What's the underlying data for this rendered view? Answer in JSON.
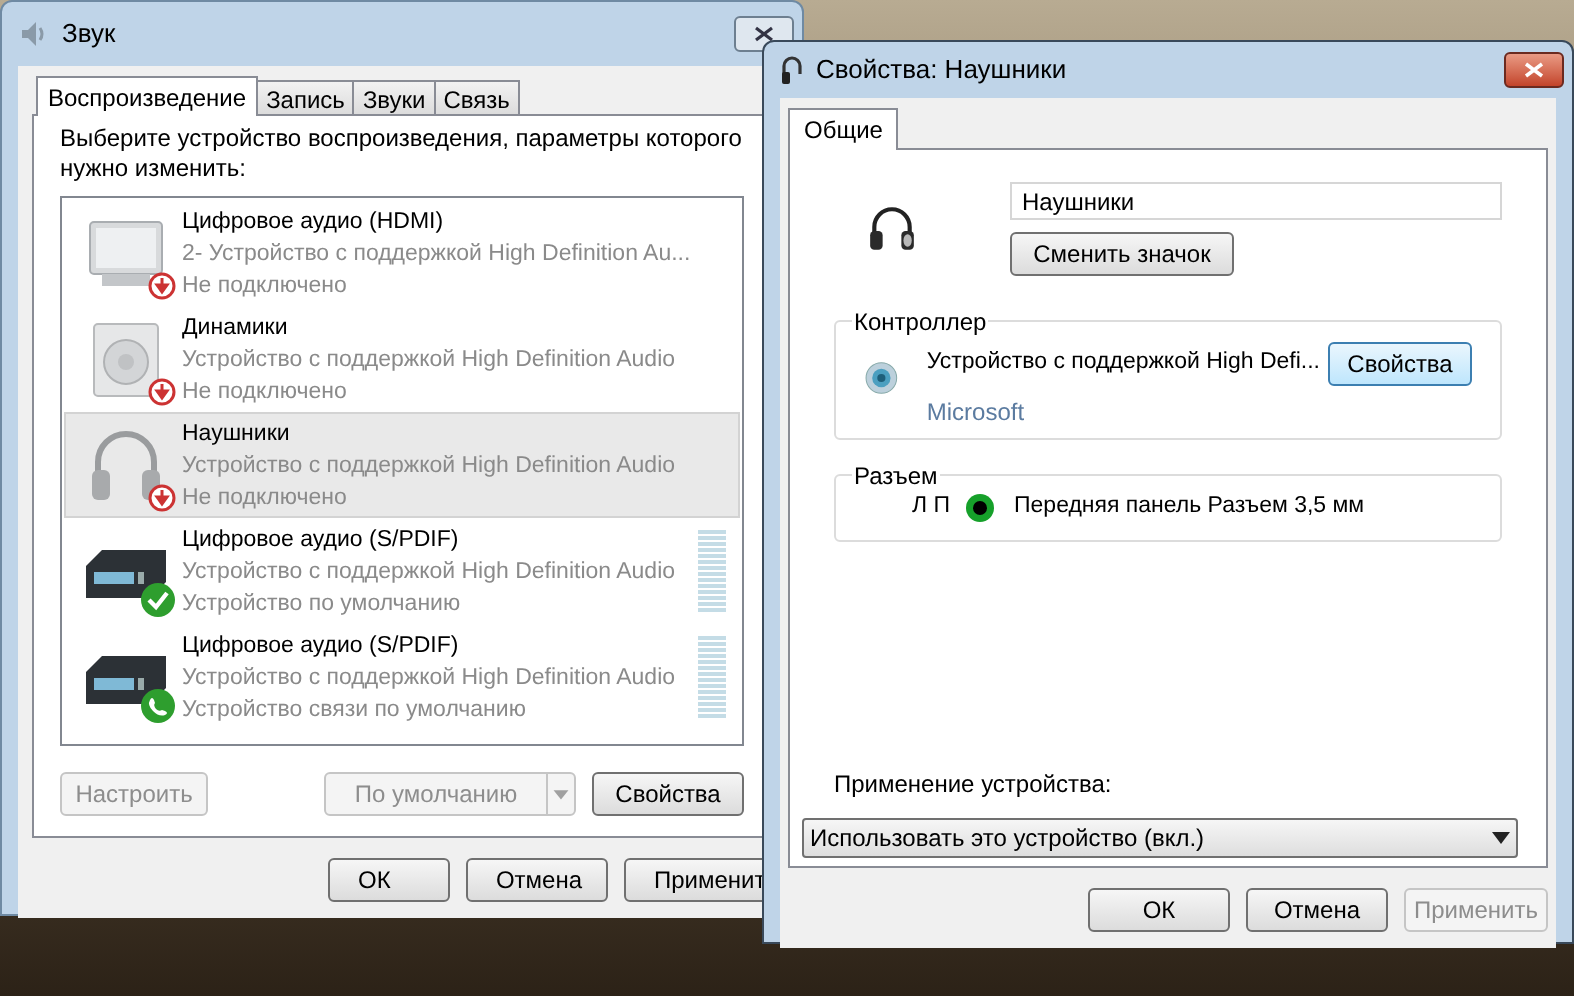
{
  "sound_window": {
    "title": "Звук",
    "tabs": [
      {
        "label": "Воспроизведение",
        "selected": true
      },
      {
        "label": "Запись",
        "selected": false
      },
      {
        "label": "Звуки",
        "selected": false
      },
      {
        "label": "Связь",
        "selected": false
      }
    ],
    "instruction": "Выберите устройство воспроизведения, параметры которого нужно изменить:",
    "devices": [
      {
        "name": "Цифровое аудио (HDMI)",
        "description": "2- Устройство с поддержкой High Definition Au...",
        "status": "Не подключено",
        "kind": "monitor",
        "badge": {
          "kind": "disconnected"
        },
        "selected": false
      },
      {
        "name": "Динамики",
        "description": "Устройство с поддержкой High Definition Audio",
        "status": "Не подключено",
        "kind": "speaker",
        "badge": {
          "kind": "disconnected"
        },
        "selected": false
      },
      {
        "name": "Наушники",
        "description": "Устройство с поддержкой High Definition Audio",
        "status": "Не подключено",
        "kind": "headphones",
        "badge": {
          "kind": "disconnected"
        },
        "selected": true
      },
      {
        "name": "Цифровое аудио (S/PDIF)",
        "description": "Устройство с поддержкой High Definition Audio",
        "status": "Устройство по умолчанию",
        "kind": "receiver",
        "badge": {
          "kind": "default"
        },
        "selected": false
      },
      {
        "name": "Цифровое аудио (S/PDIF)",
        "description": "Устройство с поддержкой High Definition Audio",
        "status": "Устройство связи по умолчанию",
        "kind": "receiver",
        "badge": {
          "kind": "communication"
        },
        "selected": false
      }
    ],
    "configure_button": {
      "label": "Настроить",
      "disabled": true
    },
    "default_button": {
      "label": "По умолчанию",
      "disabled": true
    },
    "properties_button": {
      "label": "Свойства",
      "disabled": false
    },
    "footer_buttons": [
      {
        "label": "ОК",
        "disabled": false
      },
      {
        "label": "Отмена",
        "disabled": false
      },
      {
        "label": "Применит",
        "disabled": false
      }
    ]
  },
  "properties_window": {
    "title": "Свойства: Наушники",
    "tabs": [
      {
        "label": "Общие",
        "selected": true
      }
    ],
    "name_field": {
      "value": "Наушники"
    },
    "change_icon_button": {
      "label": "Сменить значок"
    },
    "controller": {
      "heading": "Контроллер",
      "device": "Устройство с поддержкой High Defi...",
      "vendor": "Microsoft",
      "button": "Свойства"
    },
    "jack": {
      "heading": "Разъем",
      "channels": "Л П",
      "color": "#16a02a",
      "description": "Передняя панель Разъем 3,5 мм"
    },
    "usage_label": "Применение устройства:",
    "usage_select": {
      "value": "Использовать это устройство (вкл.)"
    },
    "footer_buttons": [
      {
        "label": "ОК",
        "disabled": false
      },
      {
        "label": "Отмена",
        "disabled": false
      },
      {
        "label": "Применить",
        "disabled": true
      }
    ]
  }
}
